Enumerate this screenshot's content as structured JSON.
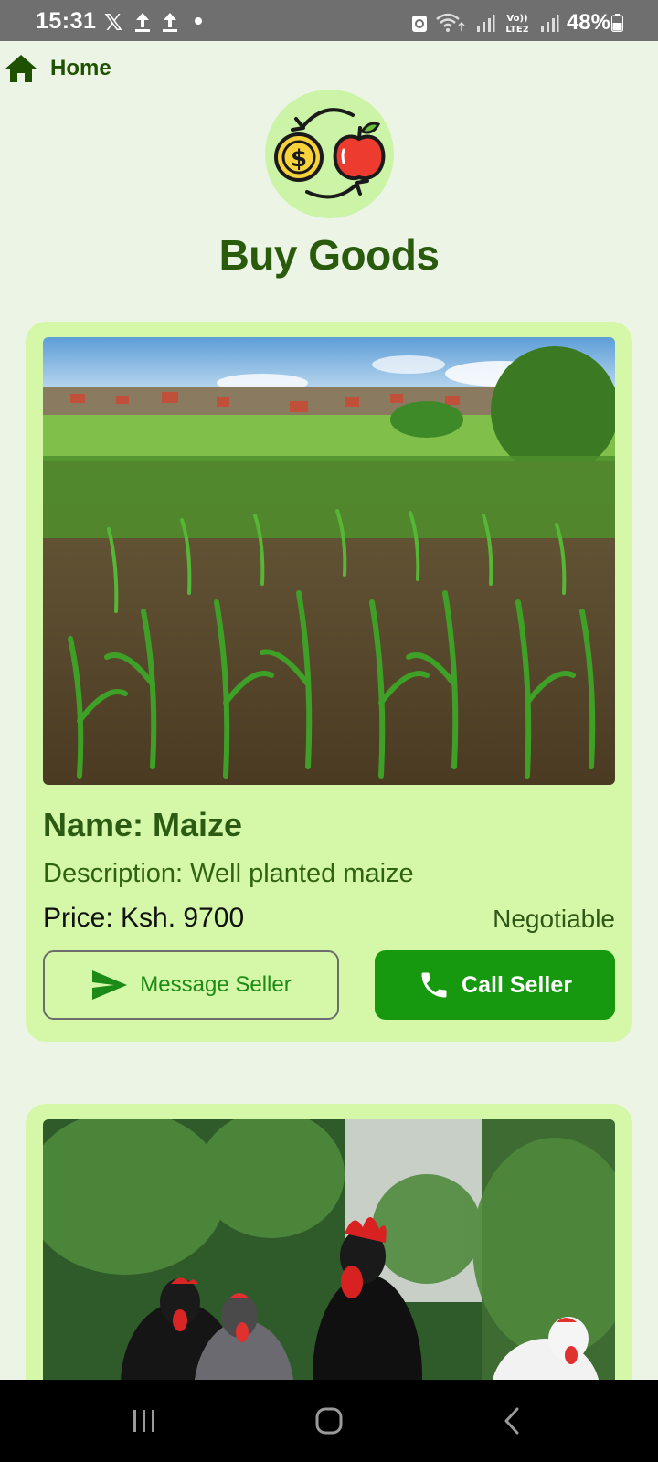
{
  "status_bar": {
    "time": "15:31",
    "x_glyph": "𝕏",
    "battery": "48%",
    "icons": [
      "x-app-icon",
      "upload-icon",
      "upload-icon",
      "notification-dot",
      "recycle-icon",
      "wifi-icon",
      "signal-icon",
      "volte-lte2-icon",
      "signal-icon",
      "battery-icon"
    ]
  },
  "nav": {
    "home_label": "Home",
    "home_icon": "home-icon"
  },
  "header": {
    "title": "Buy Goods",
    "logo_icon": "money-fruit-exchange-icon"
  },
  "listings": [
    {
      "name": "Name: Maize",
      "description": "Description: Well planted maize",
      "price": "Price: Ksh. 9700",
      "negotiable": "Negotiable",
      "message_button": "Message Seller",
      "call_button": "Call Seller",
      "image": "maize-field-photo"
    },
    {
      "image": "chickens-photo"
    }
  ],
  "colors": {
    "background": "#ecf4e6",
    "card": "#d4f8a8",
    "primary_green": "#16980f",
    "dark_green_text": "#2a5a0c"
  },
  "system_nav": [
    "recents-button",
    "home-button",
    "back-button"
  ]
}
